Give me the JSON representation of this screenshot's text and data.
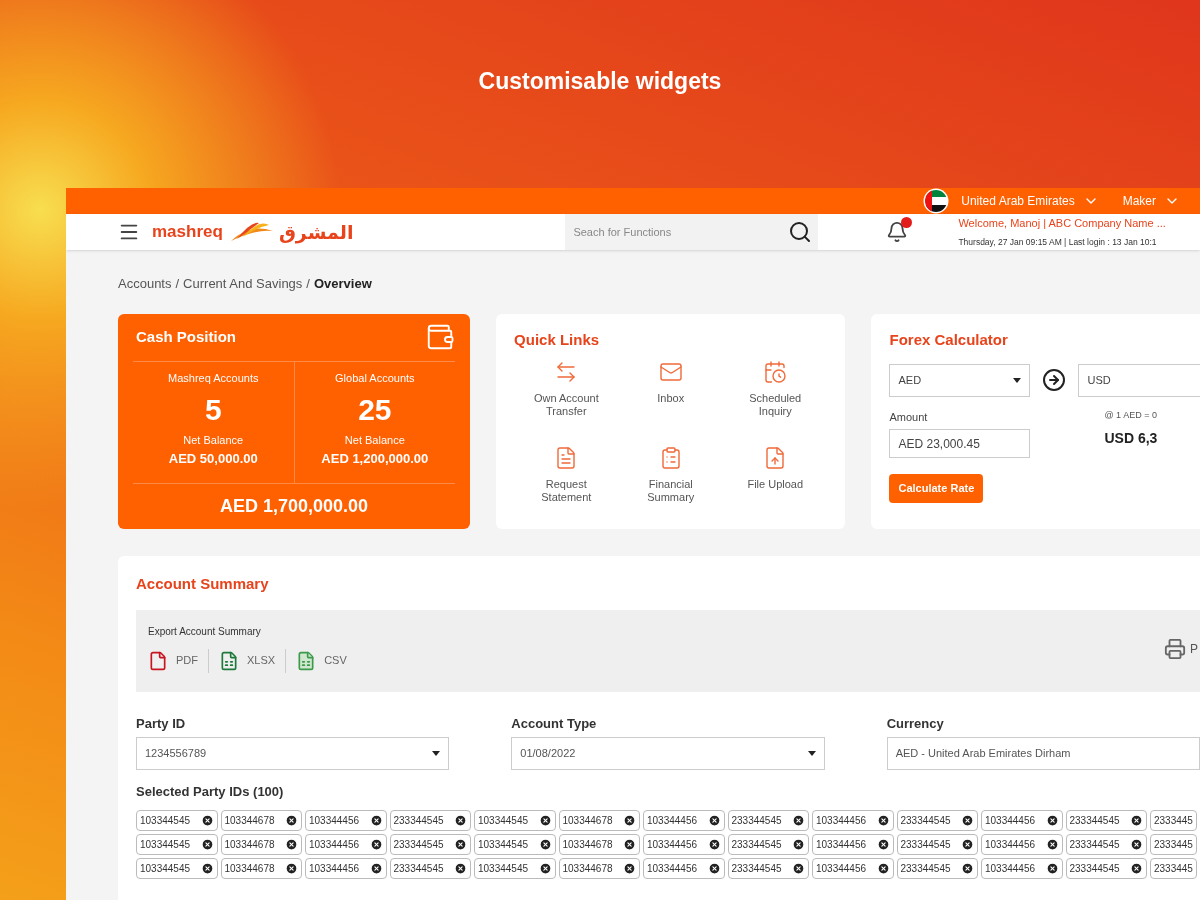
{
  "heading": "Customisable widgets",
  "top_bar": {
    "country": "United Arab Emirates",
    "role": "Maker"
  },
  "header": {
    "logo_text": "mashreq",
    "logo_arabic": "المشرق",
    "search": {
      "placeholder": "Seach for Functions"
    },
    "welcome": "Welcome, Manoj | ABC Company Name ...",
    "last_login": "Thursday, 27 Jan 09:15 AM | Last login : 13 Jan 10:1"
  },
  "breadcrumb": {
    "separator": "/",
    "items": [
      {
        "label": "Accounts",
        "current": false
      },
      {
        "label": "Current And Savings",
        "current": false
      },
      {
        "label": "Overview",
        "current": true
      }
    ]
  },
  "cash_position": {
    "title": "Cash Position",
    "groups": [
      {
        "label": "Mashreq Accounts",
        "count": "5",
        "balance_label": "Net Balance",
        "balance": "AED 50,000.00"
      },
      {
        "label": "Global Accounts",
        "count": "25",
        "balance_label": "Net Balance",
        "balance": "AED 1,200,000.00"
      }
    ],
    "total": "AED 1,700,000.00"
  },
  "quick_links": {
    "title": "Quick Links",
    "links": [
      {
        "kind": "transfer",
        "label": "Own Account Transfer"
      },
      {
        "kind": "mail",
        "label": "Inbox"
      },
      {
        "kind": "schedule",
        "label": "Scheduled Inquiry"
      },
      {
        "kind": "statement",
        "label": "Request Statement"
      },
      {
        "kind": "summary",
        "label": "Financial Summary"
      },
      {
        "kind": "upload",
        "label": "File Upload"
      }
    ]
  },
  "forex": {
    "title": "Forex Calculator",
    "from": "AED",
    "to": "USD",
    "amount_label": "Amount",
    "amount": "AED 23,000.45",
    "rate": "@ 1 AED = 0",
    "result": "USD 6,3",
    "button": "Calculate Rate"
  },
  "account_summary": {
    "title": "Account Summary",
    "export_label": "Export Account Summary",
    "formats": [
      {
        "kind": "pdf",
        "label": "PDF"
      },
      {
        "kind": "xlsx",
        "label": "XLSX"
      },
      {
        "kind": "csv",
        "label": "CSV"
      }
    ],
    "print": "P",
    "filters": [
      {
        "label": "Party ID",
        "value": "1234556789",
        "kind": "select"
      },
      {
        "label": "Account Type",
        "value": "01/08/2022",
        "kind": "select"
      },
      {
        "label": "Currency",
        "value": "AED - United Arab Emirates Dirham",
        "kind": "text"
      }
    ],
    "selected_label": "Selected Party IDs (100)",
    "chip_rows": [
      [
        "103344545",
        "103344678",
        "103344456",
        "233344545",
        "103344545",
        "103344678",
        "103344456",
        "233344545",
        "103344456",
        "233344545",
        "103344456",
        "233344545",
        "2333445"
      ],
      [
        "103344545",
        "103344678",
        "103344456",
        "233344545",
        "103344545",
        "103344678",
        "103344456",
        "233344545",
        "103344456",
        "233344545",
        "103344456",
        "233344545",
        "2333445"
      ],
      [
        "103344545",
        "103344678",
        "103344456",
        "233344545",
        "103344545",
        "103344678",
        "103344456",
        "233344545",
        "103344456",
        "233344545",
        "103344456",
        "233344545",
        "2333445"
      ]
    ]
  }
}
